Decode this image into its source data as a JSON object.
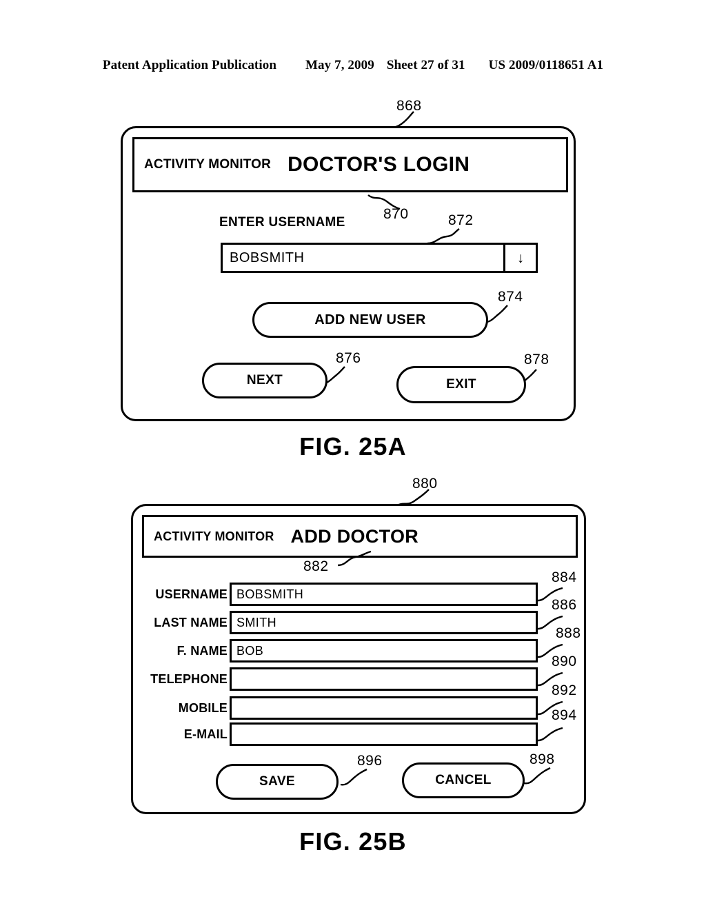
{
  "page_header": {
    "publication": "Patent Application Publication",
    "date": "May 7, 2009",
    "sheet": "Sheet 27 of 31",
    "patent_number": "US 2009/0118651 A1"
  },
  "fig25a": {
    "caption": "FIG. 25A",
    "frame_ref": "868",
    "titlebar": {
      "app_name": "ACTIVITY MONITOR",
      "screen_title": "DOCTOR'S LOGIN",
      "ref": "870"
    },
    "username_field": {
      "label": "ENTER USERNAME",
      "value": "BOBSMITH",
      "dropdown_icon": "down-arrow",
      "dropdown_glyph": "↓",
      "ref": "872"
    },
    "buttons": [
      {
        "label": "ADD NEW USER",
        "ref": "874"
      },
      {
        "label": "NEXT",
        "ref": "876"
      },
      {
        "label": "EXIT",
        "ref": "878"
      }
    ]
  },
  "fig25b": {
    "caption": "FIG. 25B",
    "frame_ref": "880",
    "titlebar": {
      "app_name": "ACTIVITY MONITOR",
      "screen_title": "ADD DOCTOR",
      "ref": "882"
    },
    "fields": [
      {
        "label": "USERNAME",
        "value": "BOBSMITH",
        "ref": "884"
      },
      {
        "label": "LAST NAME",
        "value": "SMITH",
        "ref": "886"
      },
      {
        "label": "F. NAME",
        "value": "BOB",
        "ref": "888"
      },
      {
        "label": "TELEPHONE",
        "value": "",
        "ref": "890"
      },
      {
        "label": "MOBILE",
        "value": "",
        "ref": "892"
      },
      {
        "label": "E-MAIL",
        "value": "",
        "ref": "894"
      }
    ],
    "buttons": [
      {
        "label": "SAVE",
        "ref": "896"
      },
      {
        "label": "CANCEL",
        "ref": "898"
      }
    ]
  },
  "colors": {
    "ink": "#000000",
    "paper": "#ffffff"
  }
}
